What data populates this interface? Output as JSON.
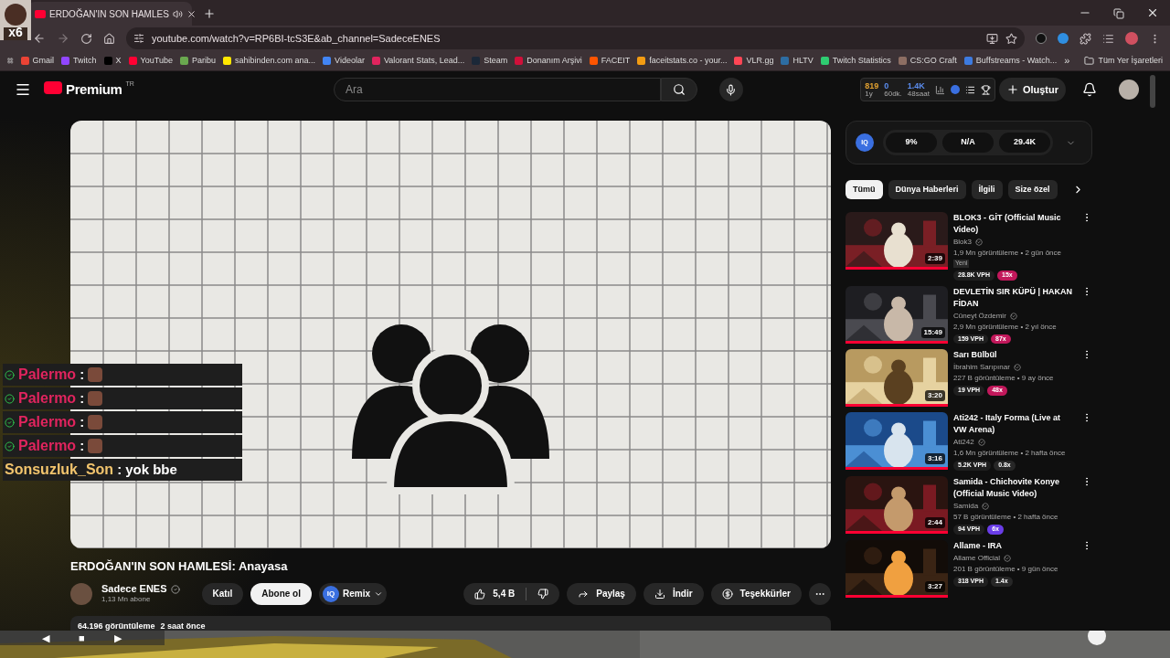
{
  "browser": {
    "tab": {
      "title": "ERDOĞAN'IN SON HAMLES",
      "audio": true
    },
    "overlay_text": "x6",
    "url": "youtube.com/watch?v=RP6BI-tcS3E&ab_channel=SadeceENES",
    "bookmarks": [
      {
        "label": "Gmail",
        "color": "#ea4335"
      },
      {
        "label": "Twitch",
        "color": "#9146ff"
      },
      {
        "label": "X",
        "color": "#000000"
      },
      {
        "label": "YouTube",
        "color": "#ff0033"
      },
      {
        "label": "Paribu",
        "color": "#6aa84f"
      },
      {
        "label": "sahibinden.com ana...",
        "color": "#ffe800"
      },
      {
        "label": "Videolar",
        "color": "#4285f4"
      },
      {
        "label": "Valorant Stats, Lead...",
        "color": "#e0245e"
      },
      {
        "label": "Steam",
        "color": "#1b2838"
      },
      {
        "label": "Donanım Arşivi",
        "color": "#d0103a"
      },
      {
        "label": "FACEIT",
        "color": "#ff5500"
      },
      {
        "label": "faceitstats.co - your...",
        "color": "#f39c12"
      },
      {
        "label": "VLR.gg",
        "color": "#ff4655"
      },
      {
        "label": "HLTV",
        "color": "#2d6da3"
      },
      {
        "label": "Twitch Statistics",
        "color": "#2ecc71"
      },
      {
        "label": "CS:GO Craft",
        "color": "#8d6e63"
      },
      {
        "label": "Buffstreams - Watch...",
        "color": "#3d7be0"
      }
    ],
    "more": "»",
    "all_bookmarks": "Tüm Yer İşaretleri"
  },
  "header": {
    "logo": "Premium",
    "region": "TR",
    "search_placeholder": "Ara",
    "stats": [
      {
        "value": "819",
        "label": "1y",
        "color": "#e0a030"
      },
      {
        "value": "0",
        "label": "60dk.",
        "color": "#5b8def"
      },
      {
        "value": "1.4K",
        "label": "48saat",
        "color": "#5b8def"
      }
    ],
    "create": "Oluştur"
  },
  "video": {
    "title": "ERDOĞAN'IN SON HAMLESİ: Anayasa",
    "channel": "Sadece ENES",
    "verified": true,
    "subscribers": "1,13 Mn abone",
    "join": "Katıl",
    "subscribe": "Abone ol",
    "remix_logo": "IQ",
    "remix": "Remix",
    "likes": "5,4 B",
    "share": "Paylaş",
    "download": "İndir",
    "thanks": "Teşekkürler",
    "views": "64.196 görüntüleme",
    "age": "2 saat önce"
  },
  "chat": {
    "separator": ":",
    "messages": [
      {
        "user": "Palermo",
        "color": "#e0245e",
        "verified": true,
        "kind": "emote"
      },
      {
        "user": "Palermo",
        "color": "#e0245e",
        "verified": true,
        "kind": "emote"
      },
      {
        "user": "Palermo",
        "color": "#e0245e",
        "verified": true,
        "kind": "emote"
      },
      {
        "user": "Palermo",
        "color": "#e0245e",
        "verified": true,
        "kind": "emote"
      },
      {
        "user": "Sonsuzluk_Son",
        "color": "#f2c46d",
        "verified": false,
        "kind": "text",
        "text": "yok bbe"
      }
    ]
  },
  "sidebar": {
    "iq_logo": "IQ",
    "iq_stats": [
      "9%",
      "N/A",
      "29.4K"
    ],
    "chips": [
      {
        "label": "Tümü",
        "selected": true
      },
      {
        "label": "Dünya Haberleri",
        "selected": false
      },
      {
        "label": "İlgili",
        "selected": false
      },
      {
        "label": "Size özel",
        "selected": false
      }
    ],
    "videos": [
      {
        "title": "BLOK3 - GİT (Official Music Video)",
        "channel": "Blok3",
        "meta": "1,9 Mn görüntüleme • 2 gün önce",
        "new_label": "Yeni",
        "duration": "2:39",
        "level": 1,
        "vph": "28.8K VPH",
        "ratio": "15x",
        "color": "#c2185b"
      },
      {
        "title": "DEVLETİN SIR KÜPÜ | HAKAN FİDAN",
        "channel": "Cüneyt Özdemir",
        "meta": "2,9 Mn görüntüleme • 2 yıl önce",
        "duration": "15:49",
        "level": 1,
        "vph": "159 VPH",
        "ratio": "87x",
        "color": "#c2185b"
      },
      {
        "title": "Sarı Bülbül",
        "channel": "İbrahim Sarıpınar",
        "meta": "227 B görüntüleme • 9 ay önce",
        "duration": "3:20",
        "level": 1,
        "vph": "19 VPH",
        "ratio": "48x",
        "color": "#c2185b"
      },
      {
        "title": "Ati242 - Italy Forma (Live at VW Arena)",
        "channel": "Ati242",
        "meta": "1,6 Mn görüntüleme • 2 hafta önce",
        "duration": "3:16",
        "level": 1,
        "vph": "5.2K VPH",
        "ratio": "0.8x",
        "color": "#272727"
      },
      {
        "title": "Samida - Chichovite Konye (Official Music Video)",
        "channel": "Samida",
        "meta": "57 B görüntüleme • 2 hafta önce",
        "duration": "2:44",
        "level": 1,
        "vph": "94 VPH",
        "ratio": "6x",
        "color": "#6a3de8"
      },
      {
        "title": "Allame - IRA",
        "channel": "Allame Official",
        "meta": "201 B görüntüleme • 9 gün önce",
        "duration": "3:27",
        "level": 1,
        "vph": "318 VPH",
        "ratio": "1.4x",
        "color": "#272727"
      }
    ]
  },
  "media_controls": [
    "◀",
    "■",
    "▶"
  ]
}
